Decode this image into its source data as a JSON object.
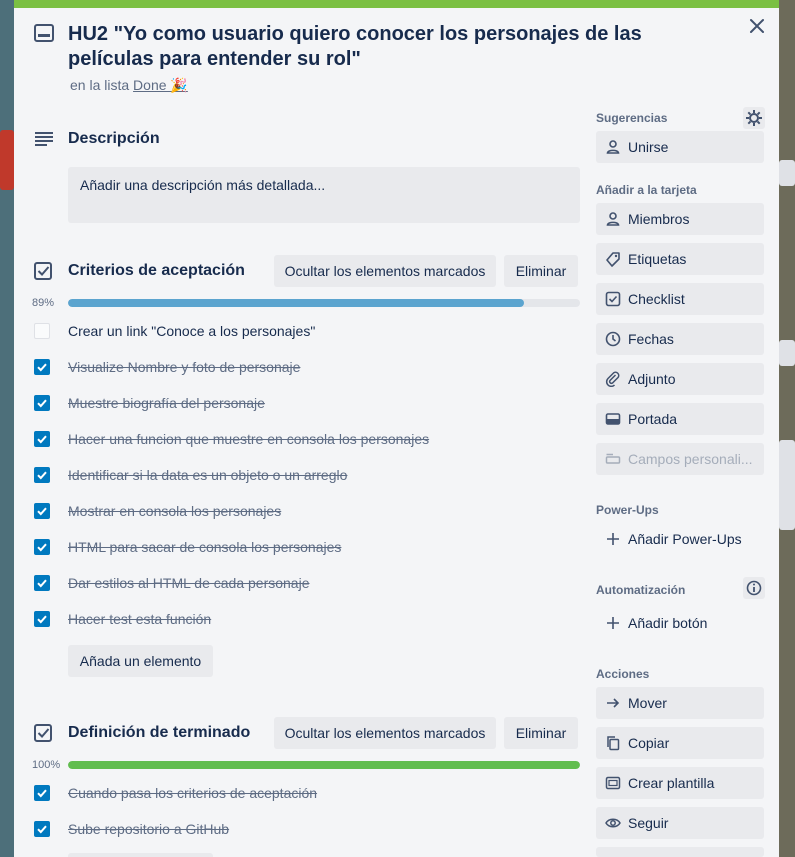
{
  "card": {
    "title": "HU2 \"Yo como usuario quiero conocer los personajes de las películas para entender su rol\"",
    "in_list_prefix": "en la lista",
    "list_name": "Done 🎉"
  },
  "description": {
    "heading": "Descripción",
    "placeholder": "Añadir una descripción más detallada..."
  },
  "checklists": [
    {
      "title": "Criterios de aceptación",
      "hide_label": "Ocultar los elementos marcados",
      "delete_label": "Eliminar",
      "percent_label": "89%",
      "progress": 0.89,
      "items": [
        {
          "text": "Crear un link \"Conoce a los personajes\"",
          "checked": false
        },
        {
          "text": "Visualize Nombre y foto de personaje",
          "checked": true
        },
        {
          "text": "Muestre biografía del personaje",
          "checked": true
        },
        {
          "text": "Hacer una funcion que muestre en consola los personajes",
          "checked": true
        },
        {
          "text": "Identificar si la data es un objeto o un arreglo",
          "checked": true
        },
        {
          "text": "Mostrar en consola los personajes",
          "checked": true
        },
        {
          "text": "HTML para sacar de consola los personajes",
          "checked": true
        },
        {
          "text": "Dar estilos al HTML de cada personaje",
          "checked": true
        },
        {
          "text": "Hacer test esta función",
          "checked": true
        }
      ],
      "add_label": "Añada un elemento"
    },
    {
      "title": "Definición de terminado",
      "hide_label": "Ocultar los elementos marcados",
      "delete_label": "Eliminar",
      "percent_label": "100%",
      "progress": 1.0,
      "items": [
        {
          "text": "Cuando pasa los criterios de aceptación",
          "checked": true
        },
        {
          "text": "Sube repositorio a GitHub",
          "checked": true
        }
      ]
    }
  ],
  "sidebar": {
    "suggestions_heading": "Sugerencias",
    "join_label": "Unirse",
    "add_to_card_heading": "Añadir a la tarjeta",
    "members_label": "Miembros",
    "labels_label": "Etiquetas",
    "checklist_label": "Checklist",
    "dates_label": "Fechas",
    "attachment_label": "Adjunto",
    "cover_label": "Portada",
    "custom_fields_label": "Campos personali...",
    "powerups_heading": "Power-Ups",
    "add_powerups_label": "Añadir Power-Ups",
    "automation_heading": "Automatización",
    "add_button_label": "Añadir botón",
    "actions_heading": "Acciones",
    "move_label": "Mover",
    "copy_label": "Copiar",
    "template_label": "Crear plantilla",
    "follow_label": "Seguir"
  },
  "colors": {
    "accent": "#0079bf",
    "progress_partial": "#5ba4cf",
    "progress_complete": "#61bd4f",
    "top_bar": "#7bc043"
  }
}
